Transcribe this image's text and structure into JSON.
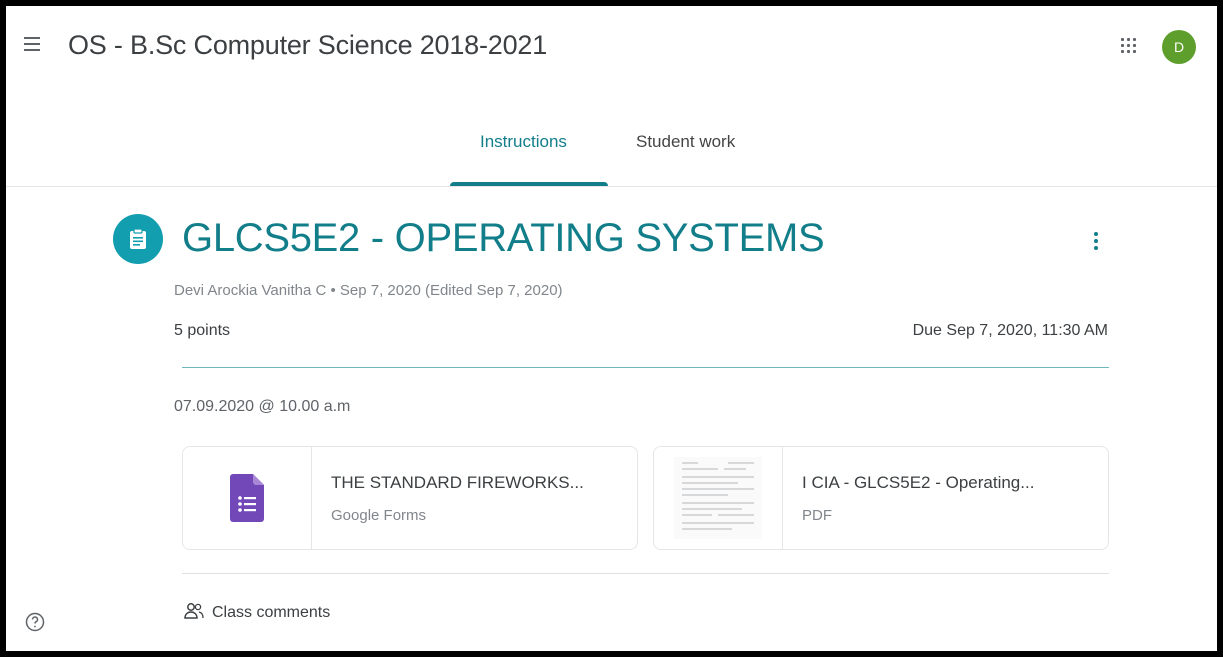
{
  "header": {
    "class_title": "OS - B.Sc Computer Science 2018-2021",
    "avatar_initial": "D",
    "avatar_color": "#5e9e2c"
  },
  "tabs": [
    {
      "label": "Instructions",
      "active": true
    },
    {
      "label": "Student work",
      "active": false
    }
  ],
  "assignment": {
    "icon": "assignment-icon",
    "title": "GLCS5E2 - OPERATING SYSTEMS",
    "meta": "Devi Arockia Vanitha C • Sep 7, 2020 (Edited Sep 7, 2020)",
    "points": "5 points",
    "due": "Due Sep 7, 2020, 11:30 AM",
    "instructions": "07.09.2020 @ 10.00 a.m",
    "accent_color": "#127e8a"
  },
  "attachments": [
    {
      "name": "THE STANDARD FIREWORKS...",
      "type": "Google Forms",
      "icon": "google-forms-icon"
    },
    {
      "name": "I CIA - GLCS5E2 - Operating...",
      "type": "PDF",
      "icon": "pdf-thumbnail"
    }
  ],
  "comments": {
    "label": "Class comments",
    "icon": "people-icon"
  },
  "footer": {
    "icon": "help-icon"
  }
}
